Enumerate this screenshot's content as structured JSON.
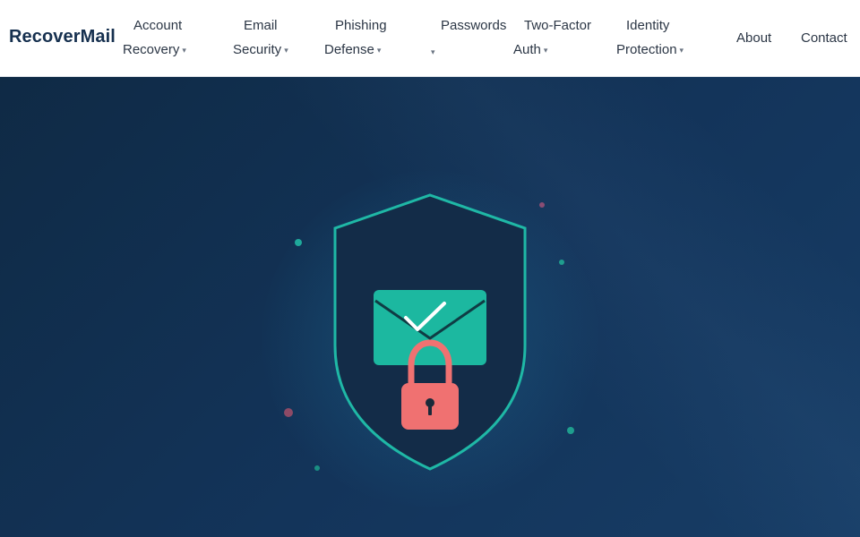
{
  "brand": {
    "name": "RecoverMail"
  },
  "nav": {
    "items": [
      {
        "line1": "Account",
        "line2": "Recovery",
        "dropdown": true
      },
      {
        "line1": "Email",
        "line2": "Security",
        "dropdown": true
      },
      {
        "line1": "Phishing",
        "line2": "Defense",
        "dropdown": true
      },
      {
        "line1": "Passwords",
        "line2": "",
        "dropdown": true
      },
      {
        "line1": "Two-Factor",
        "line2": "Auth",
        "dropdown": true
      },
      {
        "line1": "Identity",
        "line2": "Protection",
        "dropdown": true
      },
      {
        "line1": "About",
        "line2": "",
        "dropdown": false
      },
      {
        "line1": "Contact",
        "line2": "",
        "dropdown": false
      }
    ],
    "caret": "▾"
  },
  "hero": {
    "illustration": {
      "icons": [
        "shield-icon",
        "envelope-icon",
        "checkmark-icon",
        "padlock-icon"
      ]
    },
    "colors": {
      "background": "#13345a",
      "shield_fill": "#132c48",
      "shield_stroke": "#1fb8a6",
      "envelope": "#1cb8a0",
      "padlock": "#f07171",
      "check": "#ffffff"
    }
  }
}
